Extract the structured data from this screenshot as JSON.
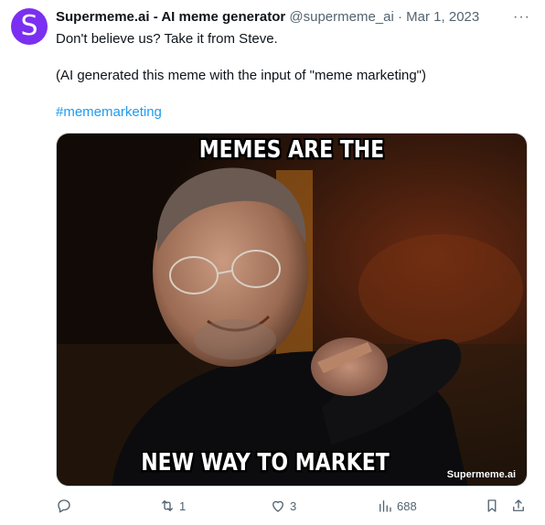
{
  "tweet": {
    "avatar_letter": "S",
    "author_name": "Supermeme.ai - AI meme generator",
    "handle": "@supermeme_ai",
    "separator": "·",
    "date": "Mar 1, 2023",
    "more": "···",
    "text_line1": "Don't believe us? Take it from Steve.",
    "text_line2": "(AI generated this meme with the input of \"meme marketing\")",
    "hashtag": "#mememarketing"
  },
  "meme": {
    "top_text": "MEMES ARE THE",
    "bottom_text": "NEW WAY TO MARKET",
    "watermark": "Supermeme.ai"
  },
  "actions": {
    "reply_count": "",
    "retweet_count": "1",
    "like_count": "3",
    "views_count": "688"
  },
  "colors": {
    "avatar": "#7b2ff0",
    "link": "#1d9bf0",
    "muted": "#536471"
  }
}
